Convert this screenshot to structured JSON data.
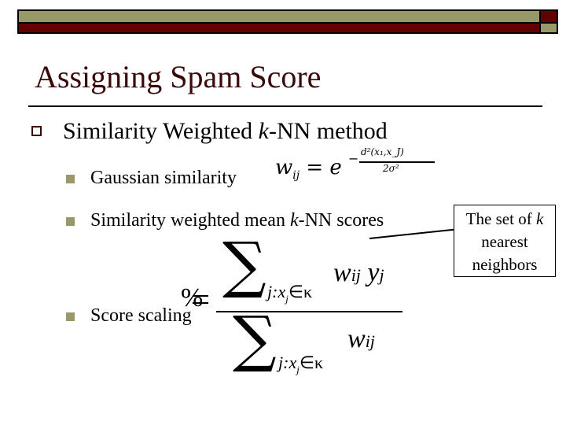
{
  "slide": {
    "title": "Assigning Spam Score",
    "colors": {
      "olive": "#989868",
      "maroon": "#630000",
      "title_text": "#3a0a0a"
    },
    "level1": {
      "text_before": "Similarity Weighted ",
      "text_italic": "k",
      "text_after": "-NN method"
    },
    "bullets": [
      {
        "text": "Gaussian similarity"
      },
      {
        "text_before": "Similarity weighted mean ",
        "text_italic": "k",
        "text_after": "-NN scores"
      },
      {
        "text": "Score scaling"
      }
    ],
    "gaussian_formula": {
      "lhs_var": "w",
      "lhs_sub": "ij",
      "equals": "=",
      "base": "e",
      "exp_sign": "−",
      "exp_numerator": "d²(x₁,x_J)",
      "exp_denominator": "2σ²"
    },
    "score_formula": {
      "sigma": "∑",
      "sum_index": "j:x",
      "sum_index_sub": "j",
      "sum_set": "∈κ",
      "numerator_w": "w",
      "numerator_w_sub": "ij",
      "numerator_y": "y",
      "numerator_y_sub": "j",
      "denominator_w": "w",
      "denominator_w_sub": "ij",
      "overlay_symbol": "%"
    },
    "callout": {
      "line1_before": "The set of ",
      "line1_italic": "k",
      "line2": "nearest",
      "line3": "neighbors"
    }
  }
}
